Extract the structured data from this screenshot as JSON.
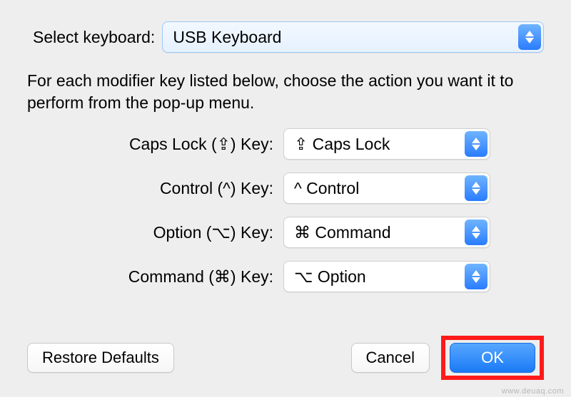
{
  "selector": {
    "label": "Select keyboard:",
    "value": "USB Keyboard"
  },
  "instructions": "For each modifier key listed below, choose the action you want it to perform from the pop-up menu.",
  "modifiers": {
    "caps_lock": {
      "label": "Caps Lock (⇪) Key:",
      "value": "⇪ Caps Lock"
    },
    "control": {
      "label": "Control (^) Key:",
      "value": "^ Control"
    },
    "option": {
      "label": "Option (⌥) Key:",
      "value": "⌘ Command"
    },
    "command": {
      "label": "Command (⌘) Key:",
      "value": "⌥ Option"
    }
  },
  "buttons": {
    "restore": "Restore Defaults",
    "cancel": "Cancel",
    "ok": "OK"
  },
  "watermark": "www.deuaq.com"
}
